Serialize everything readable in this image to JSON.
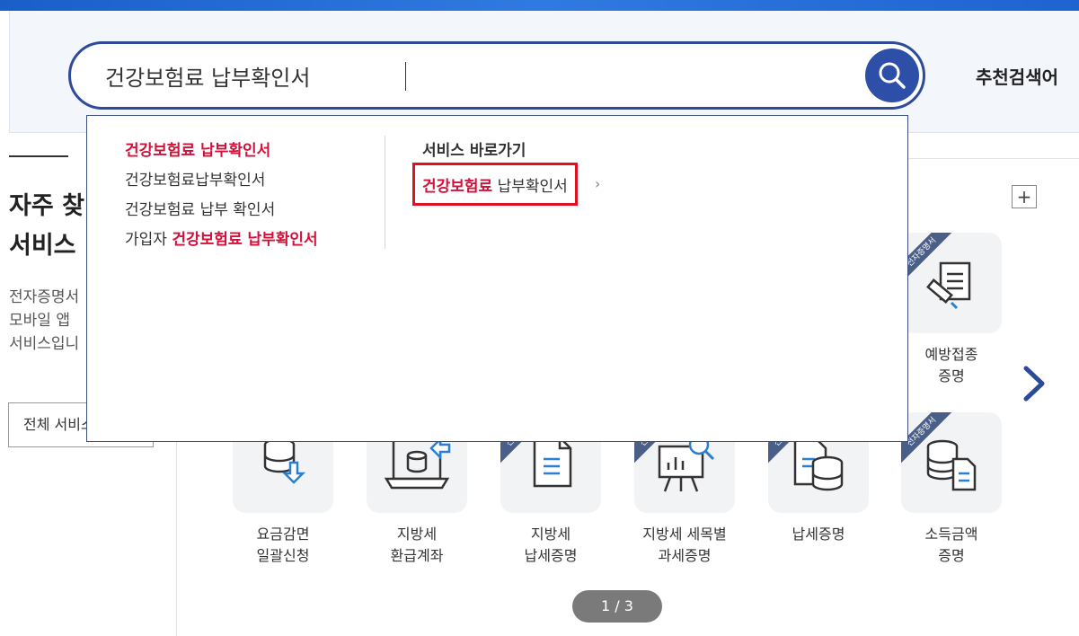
{
  "search": {
    "query": "건강보험료 납부확인서",
    "recommend_label": "추천검색어"
  },
  "left": {
    "title_line1": "자주 찾",
    "title_line2": "서비스",
    "desc_line1": "전자증명서",
    "desc_line2": "모바일 앱",
    "desc_line3": "서비스입니",
    "all_button": "전체 서비스"
  },
  "dropdown": {
    "suggestions": [
      {
        "pre": "",
        "hl": "건강보험료 납부확인서",
        "post": ""
      },
      {
        "pre": "건강보험료납부확인서",
        "hl": "",
        "post": ""
      },
      {
        "pre": "건강보험료 납부 확인서",
        "hl": "",
        "post": ""
      },
      {
        "pre": "가입자 ",
        "hl": "건강보험료 납부확인서",
        "post": ""
      }
    ],
    "shortcut_title": "서비스 바로가기",
    "shortcut_hl": "건강보험료",
    "shortcut_rest": " 납부확인서",
    "shortcut_chevron": "›"
  },
  "tiles": [
    {
      "name": "예방접종 증명",
      "line1": "예방접종",
      "line2": "증명",
      "ribbon": "전자증명서",
      "icon": "vaccine-certificate-icon"
    },
    {
      "name": "요금감면 일괄신청",
      "line1": "요금감면",
      "line2": "일괄신청",
      "ribbon": "",
      "icon": "database-download-icon"
    },
    {
      "name": "지방세 환급계좌",
      "line1": "지방세",
      "line2": "환급계좌",
      "ribbon": "",
      "icon": "laptop-database-icon"
    },
    {
      "name": "지방세 납세증명",
      "line1": "지방세",
      "line2": "납세증명",
      "ribbon": "전자증명서",
      "icon": "document-icon"
    },
    {
      "name": "지방세 세목별 과세증명",
      "line1": "지방세 세목별",
      "line2": "과세증명",
      "ribbon": "전자증명서",
      "icon": "presentation-chart-icon"
    },
    {
      "name": "납세증명",
      "line1": "납세증명",
      "line2": "",
      "ribbon": "전자증명서",
      "icon": "document-database-icon"
    },
    {
      "name": "소득금액 증명",
      "line1": "소득금액",
      "line2": "증명",
      "ribbon": "전자증명서",
      "icon": "database-document-icon"
    }
  ],
  "pager": "1 / 3",
  "colors": {
    "brand": "#2e4fa8",
    "highlight": "#d4103a",
    "ribbon": "#4a5f88"
  }
}
